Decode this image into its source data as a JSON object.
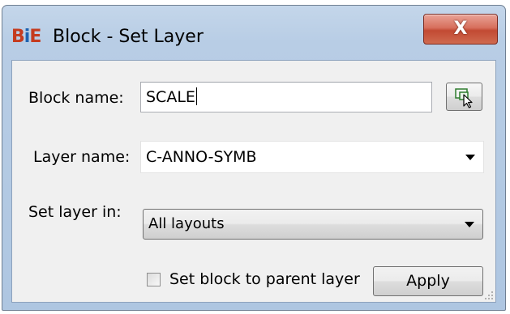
{
  "window": {
    "title": "Block - Set Layer",
    "app_icon_text": "BiE",
    "close_label": "X"
  },
  "form": {
    "block_name_label": "Block name:",
    "block_name_value": "SCALE",
    "layer_name_label": "Layer name:",
    "layer_name_value": "C-ANNO-SYMB",
    "set_layer_in_label": "Set layer in:",
    "set_layer_in_value": "All layouts",
    "parent_layer_checkbox_label": "Set block to parent layer",
    "parent_layer_checked": false,
    "apply_label": "Apply"
  },
  "icons": {
    "app": "bie-app-icon",
    "close": "close-icon",
    "pick": "pick-block-icon",
    "dropdown": "chevron-down-icon",
    "grip": "resize-grip-icon"
  },
  "colors": {
    "titlebar": "#b8cde5",
    "client": "#f0f0f0",
    "close_button": "#c24a33"
  }
}
